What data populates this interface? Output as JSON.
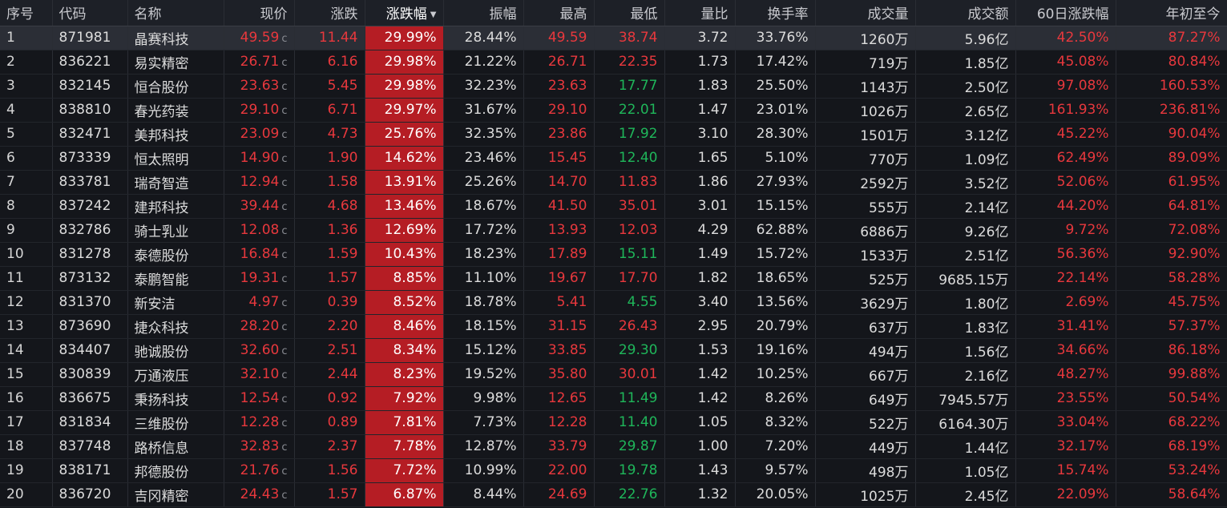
{
  "colors": {
    "up": "#e8383d",
    "down": "#1fb65a",
    "highlight": "#b51d24",
    "background": "#14161b"
  },
  "headers": [
    "序号",
    "代码",
    "名称",
    "现价",
    "涨跌",
    "涨跌幅",
    "振幅",
    "最高",
    "最低",
    "量比",
    "换手率",
    "成交量",
    "成交额",
    "60日涨跌幅",
    "年初至今"
  ],
  "sort_icon": "sort-down-icon",
  "price_marker": "c",
  "rows": [
    {
      "idx": "1",
      "code": "871981",
      "name": "晶赛科技",
      "price": "49.59",
      "chg": "11.44",
      "pct": "29.99%",
      "amp": "28.44%",
      "high": "49.59",
      "low": "38.74",
      "vr": "3.72",
      "turn": "33.76%",
      "vol": "1260万",
      "amt": "5.96亿",
      "d60": "42.50%",
      "ytd": "87.27%",
      "low_dir": "red"
    },
    {
      "idx": "2",
      "code": "836221",
      "name": "易实精密",
      "price": "26.71",
      "chg": "6.16",
      "pct": "29.98%",
      "amp": "21.22%",
      "high": "26.71",
      "low": "22.35",
      "vr": "1.73",
      "turn": "17.42%",
      "vol": "719万",
      "amt": "1.85亿",
      "d60": "45.08%",
      "ytd": "80.84%",
      "low_dir": "red"
    },
    {
      "idx": "3",
      "code": "832145",
      "name": "恒合股份",
      "price": "23.63",
      "chg": "5.45",
      "pct": "29.98%",
      "amp": "32.23%",
      "high": "23.63",
      "low": "17.77",
      "vr": "1.83",
      "turn": "25.50%",
      "vol": "1143万",
      "amt": "2.50亿",
      "d60": "97.08%",
      "ytd": "160.53%",
      "low_dir": "green"
    },
    {
      "idx": "4",
      "code": "838810",
      "name": "春光药装",
      "price": "29.10",
      "chg": "6.71",
      "pct": "29.97%",
      "amp": "31.67%",
      "high": "29.10",
      "low": "22.01",
      "vr": "1.47",
      "turn": "23.01%",
      "vol": "1026万",
      "amt": "2.65亿",
      "d60": "161.93%",
      "ytd": "236.81%",
      "low_dir": "green"
    },
    {
      "idx": "5",
      "code": "832471",
      "name": "美邦科技",
      "price": "23.09",
      "chg": "4.73",
      "pct": "25.76%",
      "amp": "32.35%",
      "high": "23.86",
      "low": "17.92",
      "vr": "3.10",
      "turn": "28.30%",
      "vol": "1501万",
      "amt": "3.12亿",
      "d60": "45.22%",
      "ytd": "90.04%",
      "low_dir": "green"
    },
    {
      "idx": "6",
      "code": "873339",
      "name": "恒太照明",
      "price": "14.90",
      "chg": "1.90",
      "pct": "14.62%",
      "amp": "23.46%",
      "high": "15.45",
      "low": "12.40",
      "vr": "1.65",
      "turn": "5.10%",
      "vol": "770万",
      "amt": "1.09亿",
      "d60": "62.49%",
      "ytd": "89.09%",
      "low_dir": "green"
    },
    {
      "idx": "7",
      "code": "833781",
      "name": "瑞奇智造",
      "price": "12.94",
      "chg": "1.58",
      "pct": "13.91%",
      "amp": "25.26%",
      "high": "14.70",
      "low": "11.83",
      "vr": "1.86",
      "turn": "27.93%",
      "vol": "2592万",
      "amt": "3.52亿",
      "d60": "52.06%",
      "ytd": "61.95%",
      "low_dir": "red"
    },
    {
      "idx": "8",
      "code": "837242",
      "name": "建邦科技",
      "price": "39.44",
      "chg": "4.68",
      "pct": "13.46%",
      "amp": "18.67%",
      "high": "41.50",
      "low": "35.01",
      "vr": "3.01",
      "turn": "15.15%",
      "vol": "555万",
      "amt": "2.14亿",
      "d60": "44.20%",
      "ytd": "64.81%",
      "low_dir": "red"
    },
    {
      "idx": "9",
      "code": "832786",
      "name": "骑士乳业",
      "price": "12.08",
      "chg": "1.36",
      "pct": "12.69%",
      "amp": "17.72%",
      "high": "13.93",
      "low": "12.03",
      "vr": "4.29",
      "turn": "62.88%",
      "vol": "6886万",
      "amt": "9.26亿",
      "d60": "9.72%",
      "ytd": "72.08%",
      "low_dir": "red"
    },
    {
      "idx": "10",
      "code": "831278",
      "name": "泰德股份",
      "price": "16.84",
      "chg": "1.59",
      "pct": "10.43%",
      "amp": "18.23%",
      "high": "17.89",
      "low": "15.11",
      "vr": "1.49",
      "turn": "15.72%",
      "vol": "1533万",
      "amt": "2.51亿",
      "d60": "56.36%",
      "ytd": "92.90%",
      "low_dir": "green"
    },
    {
      "idx": "11",
      "code": "873132",
      "name": "泰鹏智能",
      "price": "19.31",
      "chg": "1.57",
      "pct": "8.85%",
      "amp": "11.10%",
      "high": "19.67",
      "low": "17.70",
      "vr": "1.82",
      "turn": "18.65%",
      "vol": "525万",
      "amt": "9685.15万",
      "d60": "22.14%",
      "ytd": "58.28%",
      "low_dir": "red"
    },
    {
      "idx": "12",
      "code": "831370",
      "name": "新安洁",
      "price": "4.97",
      "chg": "0.39",
      "pct": "8.52%",
      "amp": "18.78%",
      "high": "5.41",
      "low": "4.55",
      "vr": "3.40",
      "turn": "13.56%",
      "vol": "3629万",
      "amt": "1.80亿",
      "d60": "2.69%",
      "ytd": "45.75%",
      "low_dir": "green"
    },
    {
      "idx": "13",
      "code": "873690",
      "name": "捷众科技",
      "price": "28.20",
      "chg": "2.20",
      "pct": "8.46%",
      "amp": "18.15%",
      "high": "31.15",
      "low": "26.43",
      "vr": "2.95",
      "turn": "20.79%",
      "vol": "637万",
      "amt": "1.83亿",
      "d60": "31.41%",
      "ytd": "57.37%",
      "low_dir": "red"
    },
    {
      "idx": "14",
      "code": "834407",
      "name": "驰诚股份",
      "price": "32.60",
      "chg": "2.51",
      "pct": "8.34%",
      "amp": "15.12%",
      "high": "33.85",
      "low": "29.30",
      "vr": "1.53",
      "turn": "19.16%",
      "vol": "494万",
      "amt": "1.56亿",
      "d60": "34.66%",
      "ytd": "86.18%",
      "low_dir": "green"
    },
    {
      "idx": "15",
      "code": "830839",
      "name": "万通液压",
      "price": "32.10",
      "chg": "2.44",
      "pct": "8.23%",
      "amp": "19.52%",
      "high": "35.80",
      "low": "30.01",
      "vr": "1.42",
      "turn": "10.25%",
      "vol": "667万",
      "amt": "2.16亿",
      "d60": "48.27%",
      "ytd": "99.88%",
      "low_dir": "red"
    },
    {
      "idx": "16",
      "code": "836675",
      "name": "秉扬科技",
      "price": "12.54",
      "chg": "0.92",
      "pct": "7.92%",
      "amp": "9.98%",
      "high": "12.65",
      "low": "11.49",
      "vr": "1.42",
      "turn": "8.26%",
      "vol": "649万",
      "amt": "7945.57万",
      "d60": "23.55%",
      "ytd": "50.54%",
      "low_dir": "green"
    },
    {
      "idx": "17",
      "code": "831834",
      "name": "三维股份",
      "price": "12.28",
      "chg": "0.89",
      "pct": "7.81%",
      "amp": "7.73%",
      "high": "12.28",
      "low": "11.40",
      "vr": "1.05",
      "turn": "8.32%",
      "vol": "522万",
      "amt": "6164.30万",
      "d60": "33.04%",
      "ytd": "68.22%",
      "low_dir": "green"
    },
    {
      "idx": "18",
      "code": "837748",
      "name": "路桥信息",
      "price": "32.83",
      "chg": "2.37",
      "pct": "7.78%",
      "amp": "12.87%",
      "high": "33.79",
      "low": "29.87",
      "vr": "1.00",
      "turn": "7.20%",
      "vol": "449万",
      "amt": "1.44亿",
      "d60": "32.17%",
      "ytd": "68.19%",
      "low_dir": "green"
    },
    {
      "idx": "19",
      "code": "838171",
      "name": "邦德股份",
      "price": "21.76",
      "chg": "1.56",
      "pct": "7.72%",
      "amp": "10.99%",
      "high": "22.00",
      "low": "19.78",
      "vr": "1.43",
      "turn": "9.57%",
      "vol": "498万",
      "amt": "1.05亿",
      "d60": "15.74%",
      "ytd": "53.24%",
      "low_dir": "green"
    },
    {
      "idx": "20",
      "code": "836720",
      "name": "吉冈精密",
      "price": "24.43",
      "chg": "1.57",
      "pct": "6.87%",
      "amp": "8.44%",
      "high": "24.69",
      "low": "22.76",
      "vr": "1.32",
      "turn": "20.05%",
      "vol": "1025万",
      "amt": "2.45亿",
      "d60": "22.09%",
      "ytd": "58.64%",
      "low_dir": "green"
    }
  ]
}
